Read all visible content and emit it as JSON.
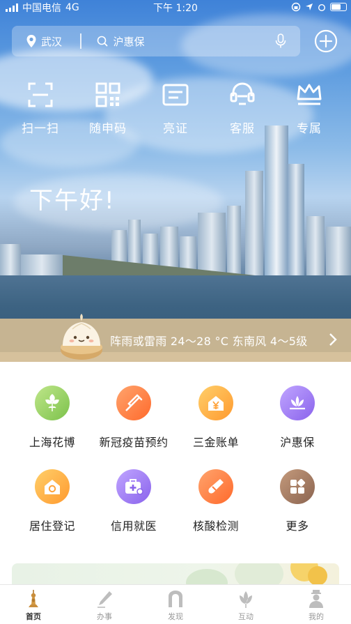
{
  "status_bar": {
    "carrier": "中国电信",
    "network": "4G",
    "time": "下午 1:20"
  },
  "search": {
    "location": "武汉",
    "placeholder": "沪惠保"
  },
  "quick_actions": [
    {
      "label": "扫一扫",
      "icon": "scan-icon"
    },
    {
      "label": "随申码",
      "icon": "qr-code-icon"
    },
    {
      "label": "亮证",
      "icon": "id-card-icon"
    },
    {
      "label": "客服",
      "icon": "customer-service-icon"
    },
    {
      "label": "专属",
      "icon": "crown-icon"
    }
  ],
  "greeting": "下午好!",
  "weather": {
    "text": "阵雨或雷雨 24～28 °C 东南风 4～5级"
  },
  "services": [
    {
      "label": "上海花博",
      "icon": "flower-icon",
      "color": "#8fcf5a"
    },
    {
      "label": "新冠疫苗预约",
      "icon": "syringe-icon",
      "color": "#ff7a3d"
    },
    {
      "label": "三金账单",
      "icon": "house-yen-icon",
      "color": "#ffab3d"
    },
    {
      "label": "沪惠保",
      "icon": "lotus-icon",
      "color": "#9b7cf0"
    },
    {
      "label": "居住登记",
      "icon": "home-icon",
      "color": "#ffab3d"
    },
    {
      "label": "信用就医",
      "icon": "medical-kit-icon",
      "color": "#9b7cf0"
    },
    {
      "label": "核酸检测",
      "icon": "test-tube-icon",
      "color": "#ff7a3d"
    },
    {
      "label": "更多",
      "icon": "grid-more-icon",
      "color": "#a37b62"
    }
  ],
  "tabs": [
    {
      "label": "首页",
      "icon": "pagoda-icon",
      "active": true
    },
    {
      "label": "办事",
      "icon": "pen-icon",
      "active": false
    },
    {
      "label": "发现",
      "icon": "arch-icon",
      "active": false
    },
    {
      "label": "互动",
      "icon": "magnolia-icon",
      "active": false
    },
    {
      "label": "我的",
      "icon": "person-icon",
      "active": false
    }
  ]
}
